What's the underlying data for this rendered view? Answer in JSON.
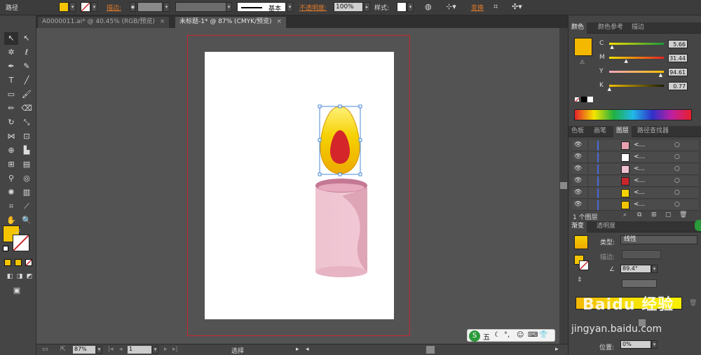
{
  "control_bar": {
    "selection_label": "路径",
    "fill_color": "#f5c400",
    "stroke_label": "描边:",
    "stroke_style_label": "基本",
    "opacity_label": "不透明度:",
    "opacity_value": "100%",
    "style_label": "样式:",
    "transform_label": "变换"
  },
  "doc_tabs": [
    {
      "label": "A0000011.ai* @ 40.45% (RGB/预览)"
    },
    {
      "label": "未标题-1* @ 87% (CMYK/预览)"
    }
  ],
  "toolbox": {
    "fill_color": "#f5c400"
  },
  "status_bar": {
    "zoom": "87%",
    "artboard": "1",
    "tool": "选择"
  },
  "color_panel": {
    "tabs": [
      "颜色",
      "颜色参考",
      "描边"
    ],
    "swatch": "#f5b800",
    "channels": [
      {
        "label": "C",
        "value": "5.66",
        "pct": 0.0566
      },
      {
        "label": "M",
        "value": "31.44",
        "pct": 0.3144
      },
      {
        "label": "Y",
        "value": "94.61",
        "pct": 0.9461
      },
      {
        "label": "K",
        "value": "0.77",
        "pct": 0.0077
      }
    ]
  },
  "layers_panel": {
    "tabs": [
      "色板",
      "画笔",
      "图层",
      "路径查找器"
    ],
    "rows": [
      {
        "name": "<...",
        "thumb": "#e8a0b0"
      },
      {
        "name": "<...",
        "thumb": "#ffffff"
      },
      {
        "name": "<...",
        "thumb": "#f0c0d0"
      },
      {
        "name": "<...",
        "thumb": "#c8272d"
      },
      {
        "name": "<...",
        "thumb": "#f5d000"
      },
      {
        "name": "<...",
        "thumb": "#f5c400"
      }
    ],
    "footer": "1 个图层"
  },
  "gradient_panel": {
    "tabs": [
      "渐变",
      "透明度"
    ],
    "type_label": "类型:",
    "type_value": "线性",
    "stroke_label": "描边:",
    "angle_value": "89.4°",
    "position_label": "位置:",
    "position_value": "0%"
  },
  "watermark": {
    "brand": "Baidu 经验",
    "url": "jingyan.baidu.com"
  },
  "ime_bar": {
    "label": "五"
  }
}
